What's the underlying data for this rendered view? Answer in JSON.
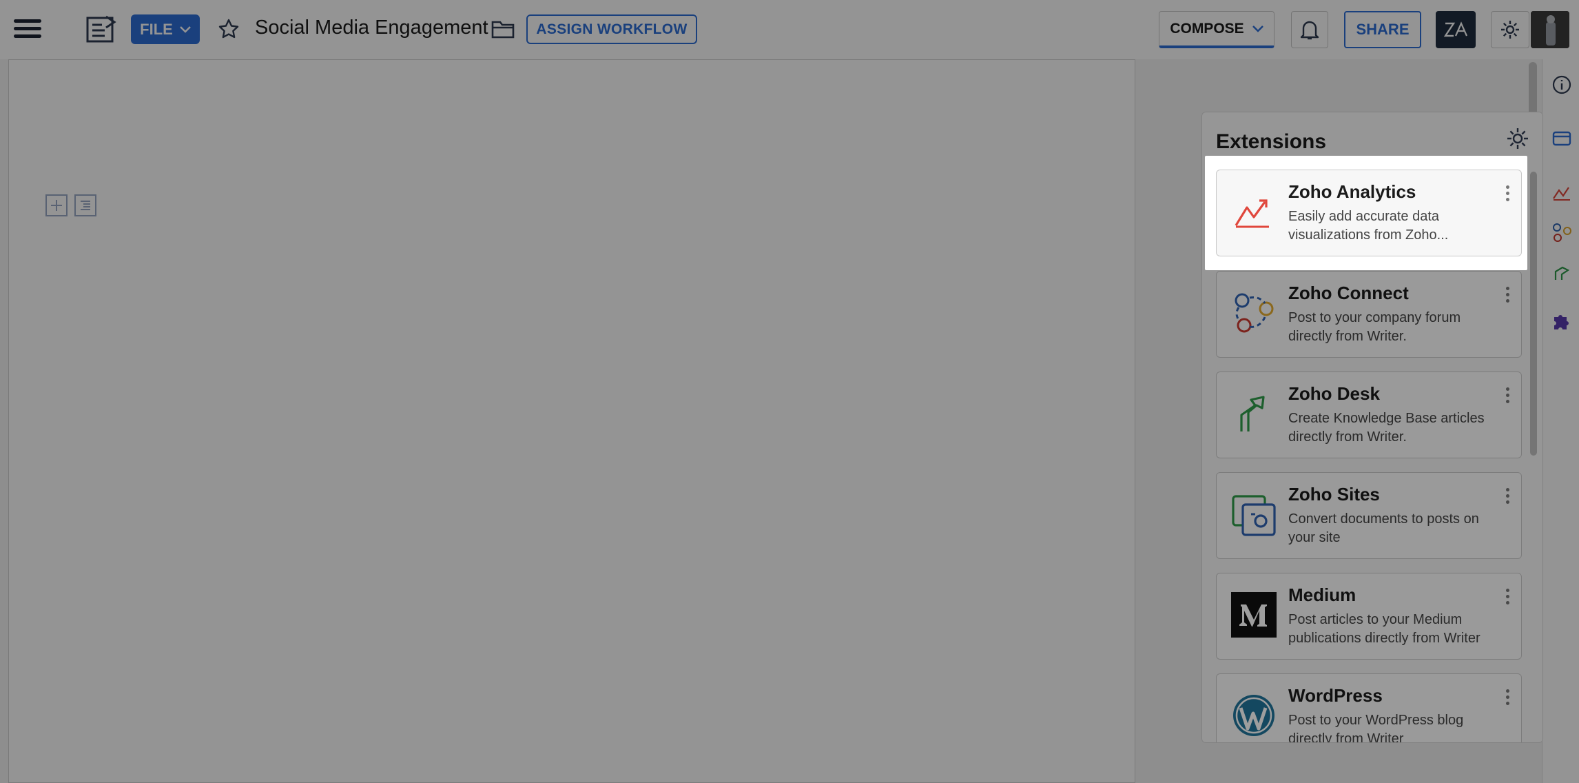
{
  "topbar": {
    "file_label": "FILE",
    "doc_title": "Social Media Engagement",
    "assign_workflow_label": "ASSIGN WORKFLOW",
    "compose_label": "COMPOSE",
    "share_label": "SHARE"
  },
  "extensions": {
    "title": "Extensions",
    "items": [
      {
        "name": "Zoho Analytics",
        "desc": "Easily add accurate data visualizations from Zoho...",
        "icon": "analytics-icon"
      },
      {
        "name": "Zoho Connect",
        "desc": "Post to your company forum directly from Writer.",
        "icon": "connect-icon"
      },
      {
        "name": "Zoho Desk",
        "desc": "Create Knowledge Base articles directly from Writer.",
        "icon": "desk-icon"
      },
      {
        "name": "Zoho Sites",
        "desc": "Convert documents to posts on your site",
        "icon": "sites-icon"
      },
      {
        "name": "Medium",
        "desc": "Post articles to your Medium publications directly from Writer",
        "icon": "medium-icon"
      },
      {
        "name": "WordPress",
        "desc": "Post to your WordPress blog directly from Writer",
        "icon": "wordpress-icon"
      }
    ]
  },
  "colors": {
    "accent": "#2e6fd8",
    "dark": "#1f2d40",
    "overlay": "rgba(0,0,0,0.42)"
  }
}
